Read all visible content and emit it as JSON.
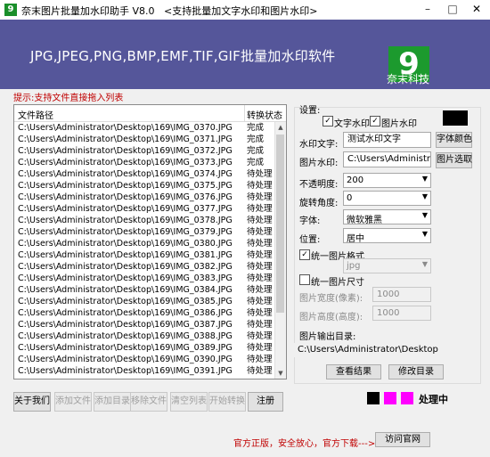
{
  "window": {
    "title": "奈末图片批量加水印助手 V8.0",
    "subtitle": "<支持批量加文字水印和图片水印>",
    "icon": "app-icon",
    "minimize_glyph": "–",
    "maximize_glyph": "□",
    "close_glyph": "✕"
  },
  "banner": {
    "title": "JPG,JPEG,PNG,BMP,EMF,TIF,GIF批量加水印软件",
    "brand": "奈末科技",
    "logo_text": "9",
    "logo_dots": "...",
    "background": "#55569a",
    "logo_color": "#1c9a2e"
  },
  "hint": "提示:支持文件直接拖入列表",
  "list": {
    "columns": [
      "文件路径",
      "转换状态"
    ],
    "rows": [
      {
        "path": "C:\\Users\\Administrator\\Desktop\\169\\IMG_0370.JPG",
        "status": "完成"
      },
      {
        "path": "C:\\Users\\Administrator\\Desktop\\169\\IMG_0371.JPG",
        "status": "完成"
      },
      {
        "path": "C:\\Users\\Administrator\\Desktop\\169\\IMG_0372.JPG",
        "status": "完成"
      },
      {
        "path": "C:\\Users\\Administrator\\Desktop\\169\\IMG_0373.JPG",
        "status": "完成"
      },
      {
        "path": "C:\\Users\\Administrator\\Desktop\\169\\IMG_0374.JPG",
        "status": "待处理"
      },
      {
        "path": "C:\\Users\\Administrator\\Desktop\\169\\IMG_0375.JPG",
        "status": "待处理"
      },
      {
        "path": "C:\\Users\\Administrator\\Desktop\\169\\IMG_0376.JPG",
        "status": "待处理"
      },
      {
        "path": "C:\\Users\\Administrator\\Desktop\\169\\IMG_0377.JPG",
        "status": "待处理"
      },
      {
        "path": "C:\\Users\\Administrator\\Desktop\\169\\IMG_0378.JPG",
        "status": "待处理"
      },
      {
        "path": "C:\\Users\\Administrator\\Desktop\\169\\IMG_0379.JPG",
        "status": "待处理"
      },
      {
        "path": "C:\\Users\\Administrator\\Desktop\\169\\IMG_0380.JPG",
        "status": "待处理"
      },
      {
        "path": "C:\\Users\\Administrator\\Desktop\\169\\IMG_0381.JPG",
        "status": "待处理"
      },
      {
        "path": "C:\\Users\\Administrator\\Desktop\\169\\IMG_0382.JPG",
        "status": "待处理"
      },
      {
        "path": "C:\\Users\\Administrator\\Desktop\\169\\IMG_0383.JPG",
        "status": "待处理"
      },
      {
        "path": "C:\\Users\\Administrator\\Desktop\\169\\IMG_0384.JPG",
        "status": "待处理"
      },
      {
        "path": "C:\\Users\\Administrator\\Desktop\\169\\IMG_0385.JPG",
        "status": "待处理"
      },
      {
        "path": "C:\\Users\\Administrator\\Desktop\\169\\IMG_0386.JPG",
        "status": "待处理"
      },
      {
        "path": "C:\\Users\\Administrator\\Desktop\\169\\IMG_0387.JPG",
        "status": "待处理"
      },
      {
        "path": "C:\\Users\\Administrator\\Desktop\\169\\IMG_0388.JPG",
        "status": "待处理"
      },
      {
        "path": "C:\\Users\\Administrator\\Desktop\\169\\IMG_0389.JPG",
        "status": "待处理"
      },
      {
        "path": "C:\\Users\\Administrator\\Desktop\\169\\IMG_0390.JPG",
        "status": "待处理"
      },
      {
        "path": "C:\\Users\\Administrator\\Desktop\\169\\IMG_0391.JPG",
        "status": "待处理"
      }
    ]
  },
  "bottom_buttons": {
    "about": "关于我们",
    "add_file": "添加文件",
    "add_dir": "添加目录",
    "remove_file": "移除文件",
    "clear_list": "清空列表",
    "start": "开始转换",
    "register": "注册"
  },
  "settings": {
    "title": "设置:",
    "text_watermark_check": "文字水印",
    "image_watermark_check": "图片水印",
    "text_watermark_label": "水印文字:",
    "text_watermark_value": "测试水印文字",
    "font_color_button": "字体颜色",
    "image_watermark_label": "图片水印:",
    "image_watermark_value": "C:\\Users\\Administrator\\",
    "select_image_button": "图片选取",
    "opacity_label": "不透明度:",
    "opacity_value": "200",
    "rotation_label": "旋转角度:",
    "rotation_value": "0",
    "font_label": "字体:",
    "font_value": "微软雅黑",
    "position_label": "位置:",
    "position_value": "居中",
    "unify_format_check": "统一图片格式",
    "format_value": "jpg",
    "unify_size_check": "统一图片尺寸",
    "width_label": "图片宽度(像素):",
    "width_value": "1000",
    "height_label": "图片高度(高度):",
    "height_value": "1000",
    "output_label": "图片输出目录:",
    "output_value": "C:\\Users\\Administrator\\Desktop",
    "view_result_button": "查看结果",
    "change_dir_button": "修改目录",
    "color_swatch": "#000000"
  },
  "status": {
    "swatch_colors": [
      "#000000",
      "#ff00ff",
      "#ff00ff"
    ],
    "processing_text": "处理中",
    "footer_text": "官方正版，安全放心，官方下载--->>",
    "visit_site_button": "访问官网"
  }
}
